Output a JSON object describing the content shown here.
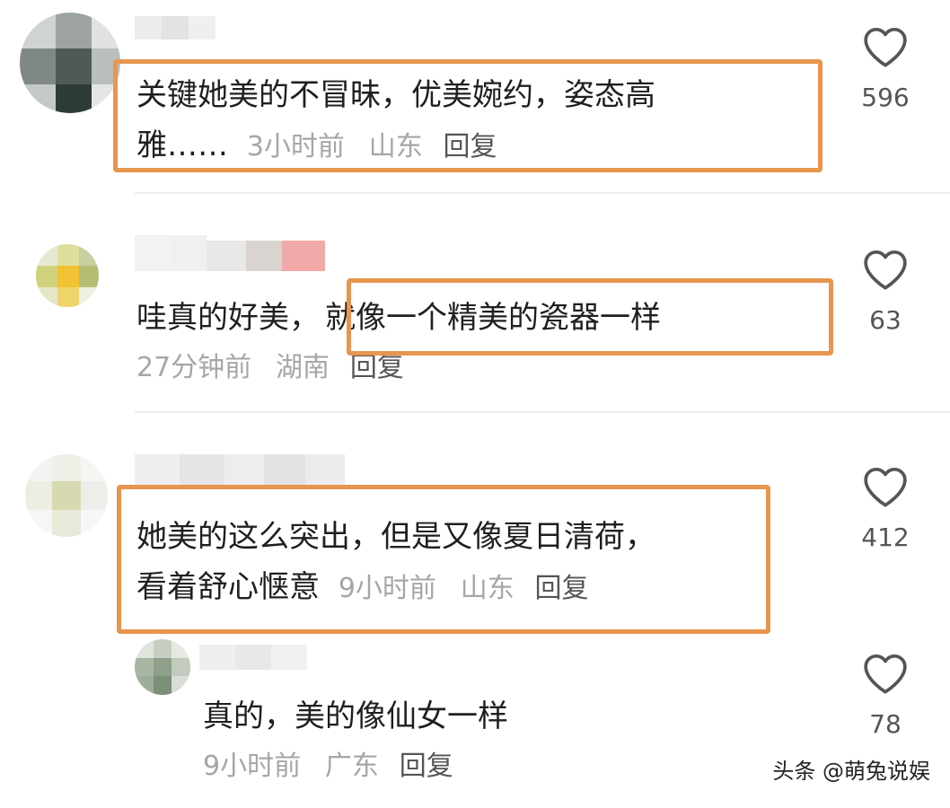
{
  "comments": [
    {
      "text_line1": "关键她美的不冒昧，优美婉约，姿态高",
      "text_line2": "雅……",
      "time": "3小时前",
      "location": "山东",
      "reply_label": "回复",
      "likes": "596"
    },
    {
      "text_prefix": "哇真的好美，",
      "text_highlight": "就像一个精美的瓷器一样",
      "time": "27分钟前",
      "location": "湖南",
      "reply_label": "回复",
      "likes": "63"
    },
    {
      "text_line1": "她美的这么突出，但是又像夏日清荷，",
      "text_line2": "看着舒心惬意",
      "time": "9小时前",
      "location": "山东",
      "reply_label": "回复",
      "likes": "412"
    }
  ],
  "sub_reply": {
    "text": "真的，美的像仙女一样",
    "time": "9小时前",
    "location": "广东",
    "reply_label": "回复",
    "likes": "78"
  },
  "watermark": "头条 @萌兔说娱",
  "colors": {
    "highlight_border": "#e8954e",
    "meta_text": "#a6a6a6"
  }
}
